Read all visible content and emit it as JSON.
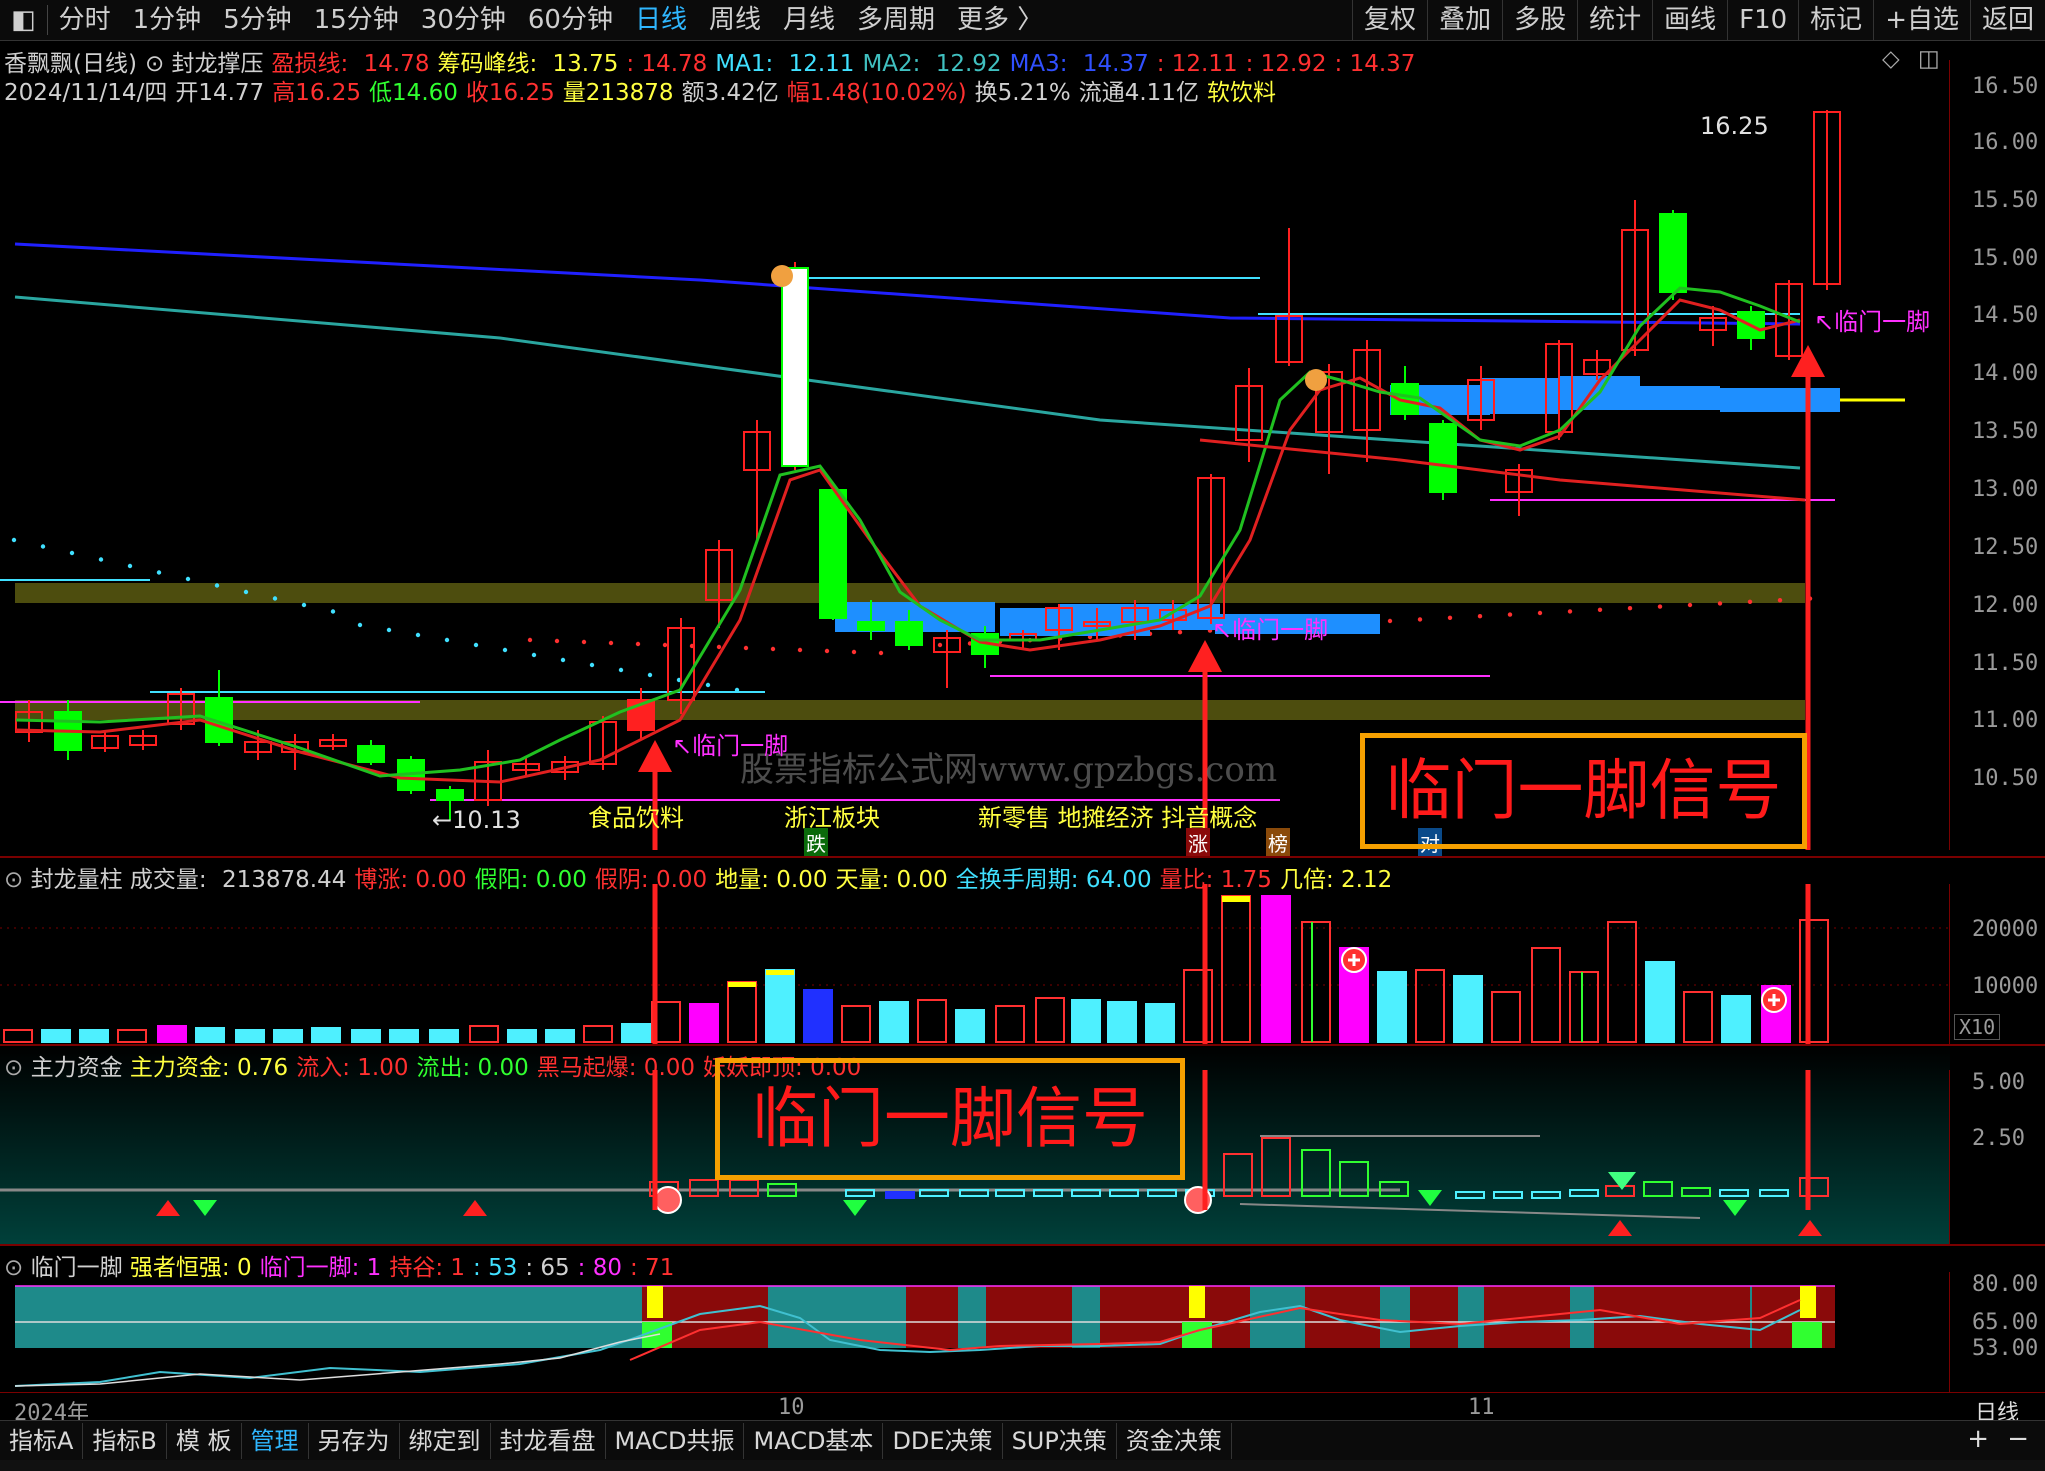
{
  "colors": {
    "up": "#ff2020",
    "down": "#00ff00",
    "cyan": "#4ef0ff",
    "magenta": "#ff00ff",
    "yellow": "#ffff00",
    "orange": "#f5a000",
    "ma_blue": "#2020ff",
    "ma_teal": "#2aa6a0",
    "ma_red": "#e02020",
    "ma_green": "#20c020"
  },
  "icons": {
    "layout": "layout-icon",
    "diamond": "diamond-icon",
    "window": "window-icon",
    "arrow": "arrow-icon"
  },
  "topbar": {
    "left": [
      "分时",
      "1分钟",
      "5分钟",
      "15分钟",
      "30分钟",
      "60分钟",
      "日线",
      "周线",
      "月线",
      "多周期",
      "更多 〉"
    ],
    "active": "日线",
    "right": [
      "复权",
      "叠加",
      "多股",
      "统计",
      "画线",
      "F10",
      "标记",
      "+自选",
      "返回"
    ]
  },
  "main": {
    "line1": [
      {
        "t": "香飘飘(日线)",
        "c": "#d0d0d0"
      },
      {
        "t": "⊙ 封龙撑压",
        "c": "#d0d0d0"
      },
      {
        "t": "盈损线: ",
        "c": "#ff3030"
      },
      {
        "t": "14.78",
        "c": "#ff3030"
      },
      {
        "t": "筹码峰线: ",
        "c": "#ffff40"
      },
      {
        "t": "13.75",
        "c": "#ffff40"
      },
      {
        "t": ": 14.78",
        "c": "#ff3030"
      },
      {
        "t": "MA1: ",
        "c": "#40e0ff"
      },
      {
        "t": "12.11",
        "c": "#40e0ff"
      },
      {
        "t": "MA2: ",
        "c": "#40c0c0"
      },
      {
        "t": "12.92",
        "c": "#40c0c0"
      },
      {
        "t": "MA3: ",
        "c": "#3050ff"
      },
      {
        "t": "14.37",
        "c": "#3050ff"
      },
      {
        "t": ": 12.11",
        "c": "#ff3030"
      },
      {
        "t": ": 12.92",
        "c": "#ff3030"
      },
      {
        "t": ": 14.37",
        "c": "#ff3030"
      }
    ],
    "line2": [
      {
        "t": "2024/11/14/四",
        "c": "#d0d0d0"
      },
      {
        "t": "开14.77",
        "c": "#d0d0d0"
      },
      {
        "t": "高16.25",
        "c": "#ff3030"
      },
      {
        "t": "低14.60",
        "c": "#30ff30"
      },
      {
        "t": "收16.25",
        "c": "#ff3030"
      },
      {
        "t": "量213878",
        "c": "#ffff40"
      },
      {
        "t": "额3.42亿",
        "c": "#d0d0d0"
      },
      {
        "t": "幅1.48(10.02%)",
        "c": "#ff3030"
      },
      {
        "t": "换5.21%",
        "c": "#d0d0d0"
      },
      {
        "t": "流通4.11亿",
        "c": "#d0d0d0"
      },
      {
        "t": "软饮料",
        "c": "#ffff40"
      }
    ],
    "y_ticks": [
      "16.50",
      "16.00",
      "15.50",
      "15.00",
      "14.50",
      "14.00",
      "13.50",
      "13.00",
      "12.50",
      "12.00",
      "11.50",
      "11.00",
      "10.50"
    ],
    "high_label": "16.25",
    "low_label": "←10.13",
    "watermark": "股票指标公式网www.gpzbgs.com",
    "concept_labels": [
      "食品饮料",
      "浙江板块",
      "新零售 地摊经济 抖音概念"
    ],
    "tags": [
      "跌",
      "涨",
      "榜",
      "对"
    ],
    "signal_label": "临门一脚",
    "banner_text": "临门一脚信号"
  },
  "vol": {
    "title": "封龙量柱",
    "items": [
      {
        "t": "成交量: ",
        "c": "#d0d0d0"
      },
      {
        "t": "213878.44",
        "c": "#d0d0d0"
      },
      {
        "t": "博涨: 0.00",
        "c": "#ff3030"
      },
      {
        "t": "假阳: 0.00",
        "c": "#30ff30"
      },
      {
        "t": "假阴: 0.00",
        "c": "#ff3030"
      },
      {
        "t": "地量: 0.00",
        "c": "#ffff40"
      },
      {
        "t": "天量: 0.00",
        "c": "#ffff40"
      },
      {
        "t": "全换手周期: 64.00",
        "c": "#40e0ff"
      },
      {
        "t": "量比: 1.75",
        "c": "#ff3030"
      },
      {
        "t": "几倍: 2.12",
        "c": "#ffff40"
      }
    ],
    "y_ticks": [
      "20000",
      "10000"
    ],
    "unit": "X10"
  },
  "fund": {
    "title": "主力资金",
    "items": [
      {
        "t": "主力资金: 0.76",
        "c": "#ffff40"
      },
      {
        "t": "流入: 1.00",
        "c": "#ff3030"
      },
      {
        "t": "流出: 0.00",
        "c": "#30ff30"
      },
      {
        "t": "黑马起爆: 0.00",
        "c": "#ff3030"
      },
      {
        "t": "妖妖即顶: 0.00",
        "c": "#ff3030"
      }
    ],
    "y_ticks": [
      "5.00",
      "2.50"
    ],
    "banner_text": "临门一脚信号"
  },
  "lmyj": {
    "title": "临门一脚",
    "items": [
      {
        "t": "强者恒强: 0",
        "c": "#ffff40"
      },
      {
        "t": "临门一脚: 1",
        "c": "#ff30ff"
      },
      {
        "t": "持谷: 1",
        "c": "#ff3030"
      },
      {
        "t": ": 53",
        "c": "#40e0ff"
      },
      {
        "t": ": 65",
        "c": "#d0d0d0"
      },
      {
        "t": ": 80",
        "c": "#ff30ff"
      },
      {
        "t": ": 71",
        "c": "#ff3030"
      }
    ],
    "y_ticks": [
      "80.00",
      "65.00",
      "53.00"
    ]
  },
  "xaxis": {
    "labels": [
      "2024年",
      "10",
      "11"
    ],
    "period": "日线"
  },
  "bottombar": {
    "tabs": [
      "指标A",
      "指标B",
      "模 板",
      "管理",
      "另存为",
      "绑定到",
      "封龙看盘",
      "MACD共振",
      "MACD基本",
      "DDE决策",
      "SUP决策",
      "资金决策"
    ],
    "active": "管理",
    "plus": "+",
    "minus": "−"
  }
}
